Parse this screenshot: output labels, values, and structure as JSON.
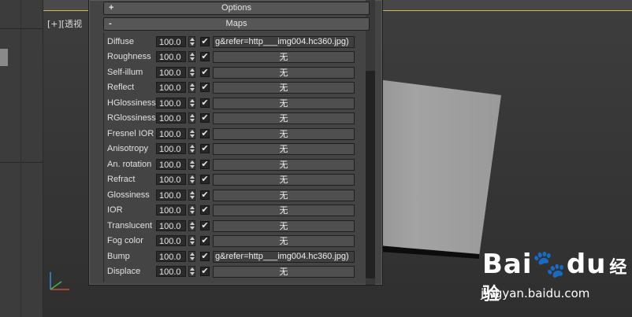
{
  "viewport": {
    "label": "[+][透视"
  },
  "panel": {
    "options_rollout": {
      "sign": "+",
      "title": "Options"
    },
    "maps_rollout": {
      "sign": "-",
      "title": "Maps"
    },
    "map_rows": [
      {
        "label": "Diffuse",
        "amount": "100.0",
        "checked": "✔",
        "slot": "g&refer=http___img004.hc360.jpg)",
        "filled": true
      },
      {
        "label": "Roughness",
        "amount": "100.0",
        "checked": "✔",
        "slot": "无",
        "filled": false
      },
      {
        "label": "Self-illum",
        "amount": "100.0",
        "checked": "✔",
        "slot": "无",
        "filled": false
      },
      {
        "label": "Reflect",
        "amount": "100.0",
        "checked": "✔",
        "slot": "无",
        "filled": false
      },
      {
        "label": "HGlossiness",
        "amount": "100.0",
        "checked": "✔",
        "slot": "无",
        "filled": false
      },
      {
        "label": "RGlossiness",
        "amount": "100.0",
        "checked": "✔",
        "slot": "无",
        "filled": false
      },
      {
        "label": "Fresnel IOR",
        "amount": "100.0",
        "checked": "✔",
        "slot": "无",
        "filled": false
      },
      {
        "label": "Anisotropy",
        "amount": "100.0",
        "checked": "✔",
        "slot": "无",
        "filled": false
      },
      {
        "label": "An. rotation",
        "amount": "100.0",
        "checked": "✔",
        "slot": "无",
        "filled": false
      },
      {
        "label": "Refract",
        "amount": "100.0",
        "checked": "✔",
        "slot": "无",
        "filled": false
      },
      {
        "label": "Glossiness",
        "amount": "100.0",
        "checked": "✔",
        "slot": "无",
        "filled": false
      },
      {
        "label": "IOR",
        "amount": "100.0",
        "checked": "✔",
        "slot": "无",
        "filled": false
      },
      {
        "label": "Translucent",
        "amount": "100.0",
        "checked": "✔",
        "slot": "无",
        "filled": false
      },
      {
        "label": "Fog color",
        "amount": "100.0",
        "checked": "✔",
        "slot": "无",
        "filled": false
      },
      {
        "label": "Bump",
        "amount": "100.0",
        "checked": "✔",
        "slot": "g&refer=http___img004.hc360.jpg)",
        "filled": true
      },
      {
        "label": "Displace",
        "amount": "100.0",
        "checked": "✔",
        "slot": "无",
        "filled": false
      }
    ]
  },
  "watermark": {
    "brand": "Bai",
    "brand_suffix": "du",
    "cn": "经验",
    "url": "jingyan.baidu.com"
  },
  "colors": {
    "accent_border": "#d8b54a",
    "panel_bg": "#444444",
    "viewport_bg": "#353535"
  }
}
